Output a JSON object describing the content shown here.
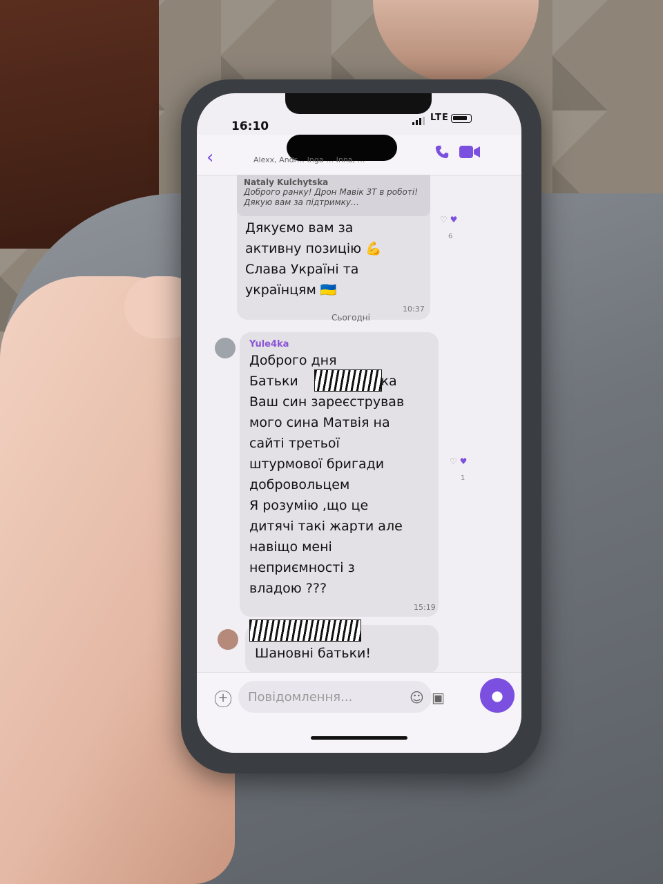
{
  "status": {
    "time": "16:10",
    "network": "LTE"
  },
  "header": {
    "participants": "Alexx, Andr… Inga … Inna, …"
  },
  "messages": [
    {
      "quote_name": "Nataly Kulchytska",
      "quote_text": "Доброго ранку! Дрон Мавік 3Т в роботі! Дякую вам за підтримку…",
      "lines": [
        "Дякуємо вам за",
        "активну позицію 💪",
        "Слава Україні та",
        "українцям 🇺🇦"
      ],
      "time": "10:37",
      "reaction_count": "6"
    },
    {
      "sender": "Yule4ka",
      "lines": [
        "Доброго дня",
        "Батьки",
        "Ваш син зареєстрував",
        "мого сина Матвія на",
        "сайті третьої",
        "штурмової бригади",
        "добровольцем",
        "Я розумію ,що це",
        "дитячі такі жарти але",
        "навіщо мені",
        "неприємності з",
        "владою ???"
      ],
      "redacted_suffix": "ака",
      "time": "15:19",
      "reaction_count": "1"
    },
    {
      "lines": [
        "Шановні батьки!"
      ]
    }
  ],
  "date_separator": "Сьогодні",
  "input": {
    "placeholder": "Повідомлення..."
  },
  "colors": {
    "accent": "#7b4fe0",
    "bubble": "#e3e0e6"
  },
  "icons": [
    "back-icon",
    "call-icon",
    "video-icon",
    "heart-icon",
    "plus-icon",
    "emoji-icon",
    "sticker-icon",
    "mic-icon",
    "arrow-down-icon"
  ]
}
